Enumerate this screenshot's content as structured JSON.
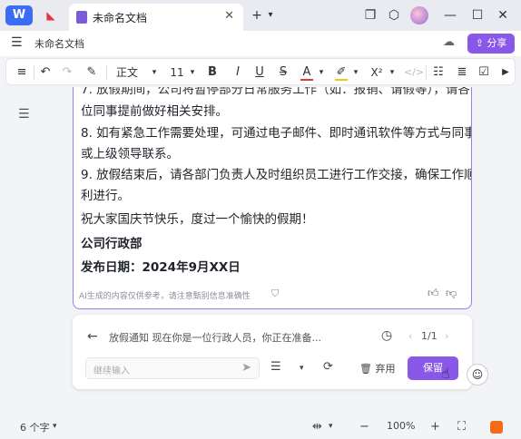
{
  "titlebar": {
    "app_logo": "W",
    "pdf_tab_icon": "PDF",
    "doc_tab_label": "未命名文档",
    "new_tab": "+",
    "dropdown": "▾"
  },
  "menubar": {
    "doc_title": "未命名文档",
    "share_label": "分享"
  },
  "toolbar": {
    "style": "正文",
    "font_size": "11",
    "bold": "B",
    "italic": "I",
    "underline": "U",
    "strike": "S",
    "font_color": "A",
    "superscript": "X²"
  },
  "document": {
    "lines": [
      "7.  放假期间，公司将暂停部分日常服务工作（如：报销、请假等），请各",
      "     位同事提前做好相关安排。",
      "8.  如有紧急工作需要处理，可通过电子邮件、即时通讯软件等方式与同事",
      "     或上级领导联系。",
      "9.  放假结束后，请各部门负责人及时组织员工进行工作交接，确保工作顺",
      "     利进行。",
      "祝大家国庆节快乐，度过一个愉快的假期！",
      "公司行政部",
      "发布日期：2024年9月XX日"
    ],
    "ai_disclaimer": "AI生成的内容仅供参考，请注意甄别信息准确性"
  },
  "ai_panel": {
    "prompt": "放假通知  现在你是一位行政人员，你正在准备...",
    "page_indicator": "1/1",
    "continue_placeholder": "继续输入",
    "discard_label": "弃用",
    "keep_label": "保留"
  },
  "statusbar": {
    "word_count": "6 个字",
    "zoom": "100%"
  },
  "colors": {
    "accent": "#8a58e8",
    "brand_blue": "#3b6cf4"
  }
}
